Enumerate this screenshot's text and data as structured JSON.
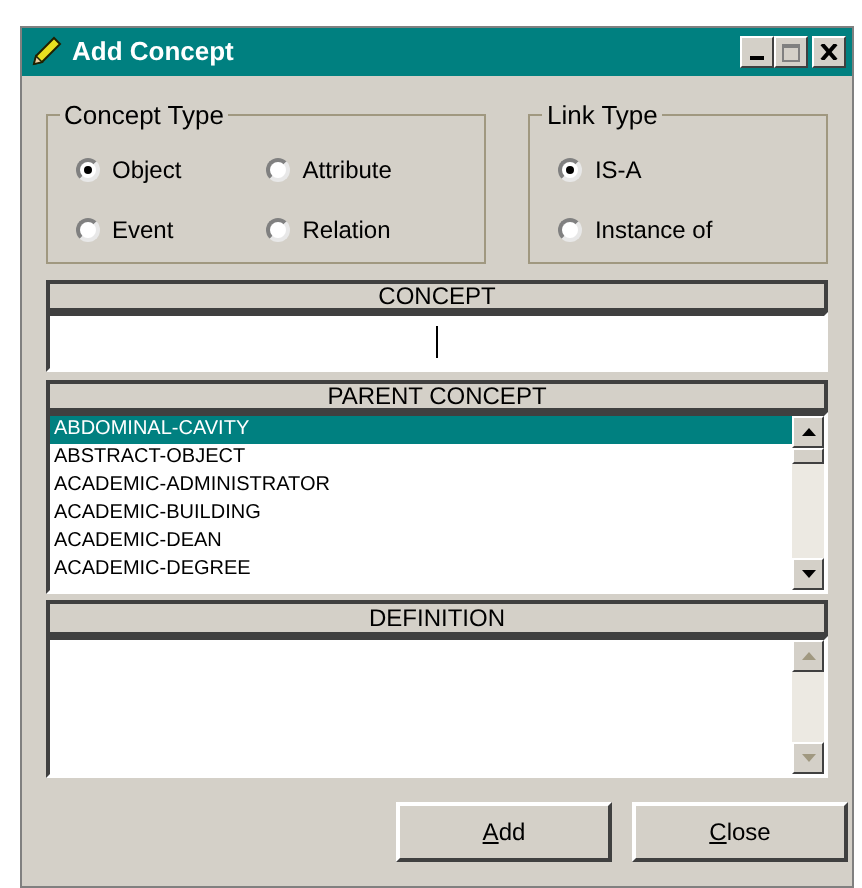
{
  "window": {
    "title": "Add Concept"
  },
  "concept_type": {
    "legend": "Concept Type",
    "options": [
      {
        "label": "Object",
        "selected": true
      },
      {
        "label": "Attribute",
        "selected": false
      },
      {
        "label": "Event",
        "selected": false
      },
      {
        "label": "Relation",
        "selected": false
      }
    ]
  },
  "link_type": {
    "legend": "Link Type",
    "options": [
      {
        "label": "IS-A",
        "selected": true
      },
      {
        "label": "Instance of",
        "selected": false
      }
    ]
  },
  "concept": {
    "header": "CONCEPT"
  },
  "parent_concept": {
    "header": "PARENT CONCEPT",
    "items": [
      {
        "label": "ABDOMINAL-CAVITY",
        "selected": true
      },
      {
        "label": "ABSTRACT-OBJECT",
        "selected": false
      },
      {
        "label": "ACADEMIC-ADMINISTRATOR",
        "selected": false
      },
      {
        "label": "ACADEMIC-BUILDING",
        "selected": false
      },
      {
        "label": "ACADEMIC-DEAN",
        "selected": false
      },
      {
        "label": "ACADEMIC-DEGREE",
        "selected": false
      }
    ]
  },
  "definition": {
    "header": "DEFINITION"
  },
  "buttons": [
    {
      "label": "Add"
    },
    {
      "label": "Close"
    }
  ]
}
